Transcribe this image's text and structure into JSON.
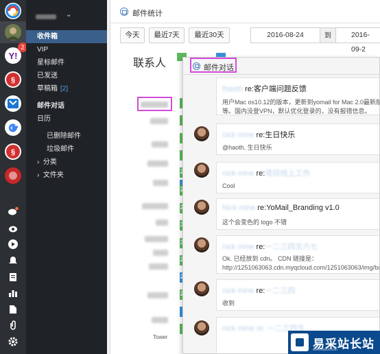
{
  "rail": {
    "badge_count": "2"
  },
  "sidebar": {
    "account_caret": "⌄",
    "folders": [
      {
        "label": "收件箱",
        "count": ""
      },
      {
        "label": "VIP",
        "count": ""
      },
      {
        "label": "星标邮件",
        "count": ""
      },
      {
        "label": "已发送",
        "count": ""
      },
      {
        "label": "草稿箱",
        "count": "[2]"
      },
      {
        "label": "邮件对话",
        "count": ""
      },
      {
        "label": "日历",
        "count": ""
      },
      {
        "label": "已删除邮件",
        "count": ""
      },
      {
        "label": "垃圾邮件",
        "count": ""
      },
      {
        "label": "分类",
        "count": ""
      },
      {
        "label": "文件夹",
        "count": ""
      }
    ],
    "tree_arrow": "›"
  },
  "main": {
    "title": "邮件统计",
    "range_buttons": [
      "今天",
      "最近7天",
      "最近30天"
    ],
    "date_from": "2016-08-24",
    "date_to_label": "到",
    "date_to": "2016-09-2",
    "contacts_title": "联系人",
    "bar_numbers": [
      "2",
      "2",
      "2",
      "3",
      "3",
      "2",
      "2",
      "2"
    ],
    "bottom_name": "Tower"
  },
  "dialog": {
    "title": "邮件对话",
    "messages": [
      {
        "prefix": "re:",
        "subject": "客户端问题反馈",
        "body": [
          "用户Mac os10.12的版本，更新到yomail for Mac 2.0最新版",
          "等。国内没登VPN，默认优化登录的，没有报错信息。"
        ]
      },
      {
        "prefix": "re:",
        "subject": "生日快乐",
        "body": [
          "@haoth, 生日快乐"
        ]
      },
      {
        "prefix": "re:",
        "subject": "",
        "body": [
          "Cool"
        ]
      },
      {
        "prefix": "re:",
        "subject": "YoMail_Branding v1.0",
        "body": [
          "这个会变色的 logo 不错"
        ]
      },
      {
        "prefix": "re:",
        "subject": "",
        "body": [
          "Ok. 已经放到 cdn。 CDN 链接是：",
          "http://1251063063.cdn.myqcloud.com/1251063063/img/ba"
        ]
      },
      {
        "prefix": "re:",
        "subject": "",
        "body": [
          "收到"
        ]
      }
    ]
  },
  "watermark": {
    "text": "易采站长站",
    "url": "www.easck.com"
  }
}
